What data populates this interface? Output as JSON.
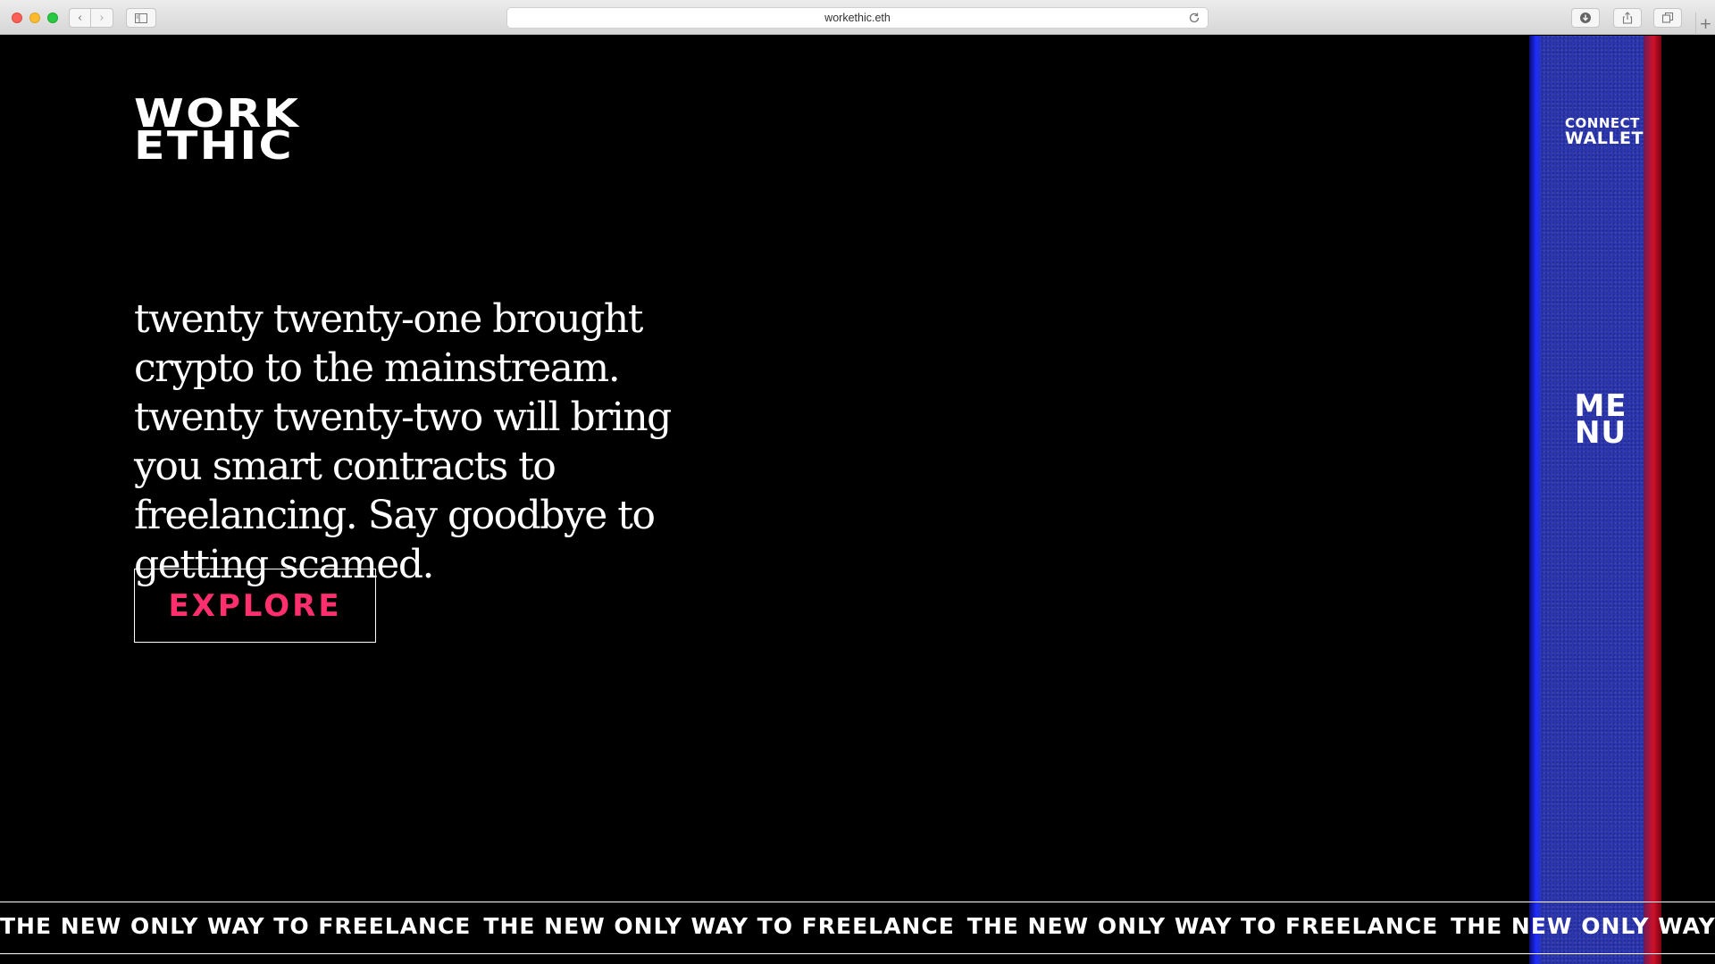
{
  "browser": {
    "url": "workethic.eth"
  },
  "site": {
    "logo_line1": "WORK",
    "logo_line2": "ETHIC",
    "hero_text": "twenty twenty-one brought crypto to the mainstream. twenty twenty-two will bring you smart contracts to freelancing. Say goodbye to getting scamed.",
    "explore_label": "EXPLORE",
    "connect_line1": "CONNECT",
    "connect_line2": "WALLET",
    "menu_line1": "ME",
    "menu_line2": "NU",
    "marquee_text": "THE NEW ONLY WAY TO FREELANCE",
    "colors": {
      "background": "#000000",
      "accent_pink": "#ff2f6e",
      "panel_blue": "#2b36b0",
      "panel_red_edge": "#d0122a"
    }
  }
}
